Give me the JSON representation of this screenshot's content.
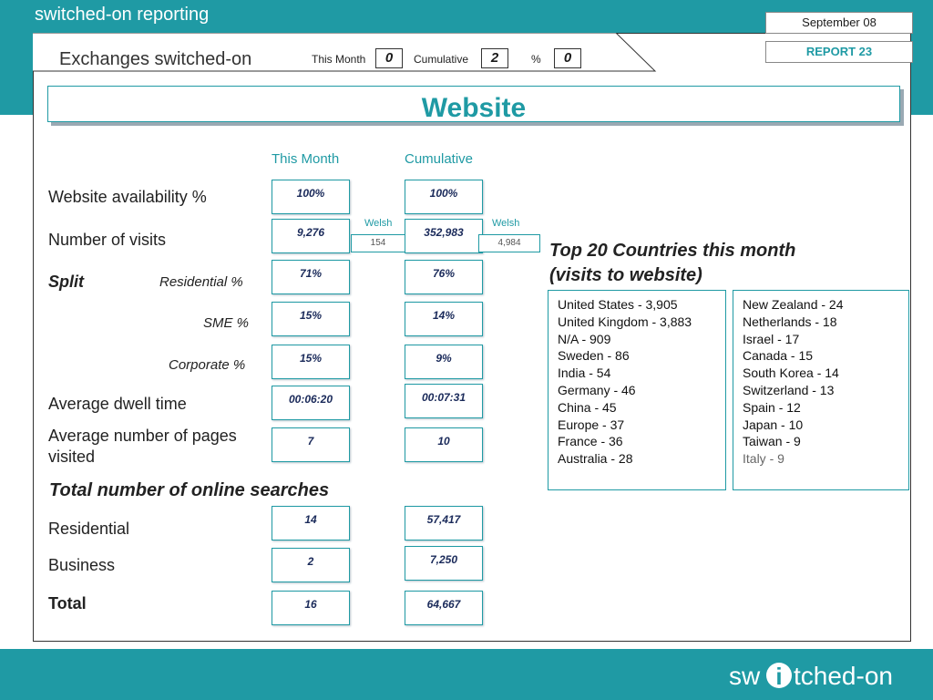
{
  "app_title": "switched-on reporting",
  "header": {
    "date": "September 08",
    "report": "REPORT 23",
    "exchanges_title": "Exchanges switched-on",
    "this_month_label": "This Month",
    "this_month_value": "0",
    "cumulative_label": "Cumulative",
    "cumulative_value": "2",
    "percent_label": "%",
    "percent_value": "0"
  },
  "section_title": "Website",
  "columns": {
    "this_month": "This Month",
    "cumulative": "Cumulative"
  },
  "welsh_label": "Welsh",
  "metrics": {
    "availability": {
      "label": "Website availability %",
      "month": "100%",
      "cumulative": "100%"
    },
    "visits": {
      "label": "Number of visits",
      "month": "9,276",
      "cumulative": "352,983",
      "welsh_month": "154",
      "welsh_cumulative": "4,984"
    },
    "split_label": "Split",
    "residential": {
      "label": "Residential %",
      "month": "71%",
      "cumulative": "76%"
    },
    "sme": {
      "label": "SME %",
      "month": "15%",
      "cumulative": "14%"
    },
    "corporate": {
      "label": "Corporate %",
      "month": "15%",
      "cumulative": "9%"
    },
    "dwell": {
      "label": "Average dwell time",
      "month": "00:06:20",
      "cumulative": "00:07:31"
    },
    "pages": {
      "label": "Average number of pages visited",
      "month": "7",
      "cumulative": "10"
    }
  },
  "searches": {
    "title": "Total number of online searches",
    "residential": {
      "label": "Residential",
      "month": "14",
      "cumulative": "57,417"
    },
    "business": {
      "label": "Business",
      "month": "2",
      "cumulative": "7,250"
    },
    "total": {
      "label": "Total",
      "month": "16",
      "cumulative": "64,667"
    }
  },
  "countries": {
    "title_line1": "Top 20 Countries this month",
    "title_line2": "(visits to website)",
    "list1": [
      "United States - 3,905",
      "United Kingdom - 3,883",
      "N/A - 909",
      "Sweden - 86",
      "India - 54",
      "Germany - 46",
      "China - 45",
      "Europe - 37",
      "France - 36",
      "Australia - 28"
    ],
    "list2": [
      "New Zealand - 24",
      "Netherlands - 18",
      "Israel - 17",
      "Canada - 15",
      "South Korea - 14",
      "Switzerland - 13",
      "Spain - 12",
      "Japan - 10",
      "Taiwan - 9",
      "Italy - 9"
    ]
  },
  "logo_text": {
    "part1": "sw",
    "part2": "i",
    "part3": "tched-on"
  },
  "colors": {
    "brand": "#1f9aa4",
    "value_text": "#1a2a5a"
  }
}
